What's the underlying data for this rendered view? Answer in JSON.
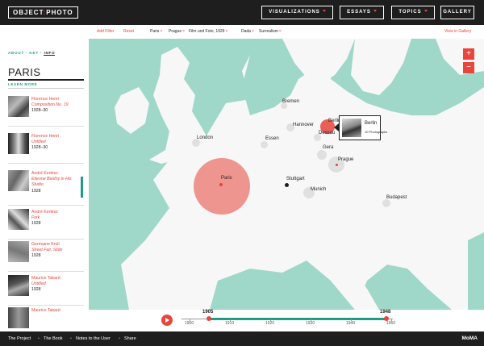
{
  "header": {
    "logo_left": "OBJECT",
    "logo_sep": ":",
    "logo_right": "PHOTO",
    "nav": [
      {
        "label": "VISUALIZATIONS",
        "has_menu": true
      },
      {
        "label": "ESSAYS",
        "has_menu": true
      },
      {
        "label": "TOPICS",
        "has_menu": true
      },
      {
        "label": "GALLERY",
        "has_menu": false
      }
    ]
  },
  "sidebar": {
    "tabs": [
      "ABOUT",
      "KEY",
      "INFO"
    ],
    "active_tab": "INFO",
    "title": "PARIS",
    "learn_more": "LEARN MORE",
    "items": [
      {
        "artist": "Florence Henri",
        "title": "Composition No. 19",
        "date": "1928–30"
      },
      {
        "artist": "Florence Henri",
        "title": "Untitled",
        "date": "1928–30"
      },
      {
        "artist": "André Kertész",
        "title": "Etienne Beothy in His Studio",
        "date": "1928"
      },
      {
        "artist": "André Kertész",
        "title": "Fork",
        "date": "1928"
      },
      {
        "artist": "Germaine Krull",
        "title": "Street Fair, Slide",
        "date": "1928"
      },
      {
        "artist": "Maurice Tabard",
        "title": "Untitled",
        "date": "1928"
      },
      {
        "artist": "Maurice Tabard",
        "title": "",
        "date": ""
      }
    ]
  },
  "filters": {
    "add_filter": "Add Filter",
    "reset": "Reset",
    "tags": [
      "Paris",
      "Prague",
      "Film und Foto, 1929",
      "Dada",
      "Surrealism"
    ],
    "remove_glyph": "×",
    "view_in_gallery": "View in Gallery"
  },
  "map": {
    "cities": [
      {
        "name": "Paris"
      },
      {
        "name": "London"
      },
      {
        "name": "Bremen"
      },
      {
        "name": "Hannover"
      },
      {
        "name": "Berlin"
      },
      {
        "name": "Essen"
      },
      {
        "name": "Dessau"
      },
      {
        "name": "Gera"
      },
      {
        "name": "Prague"
      },
      {
        "name": "Stuttgart"
      },
      {
        "name": "Munich"
      },
      {
        "name": "Budapest"
      }
    ],
    "zoom_in": "+",
    "zoom_out": "−",
    "colors": {
      "water": "#9fd8c8",
      "land": "#f7f7f7",
      "accent": "#e8453c",
      "teal": "#1f9c86"
    }
  },
  "tooltip": {
    "city": "Berlin",
    "count": "10 Photographs"
  },
  "timeline": {
    "start_year": "1905",
    "end_year": "1948",
    "ticks": [
      "1900",
      "1910",
      "1920",
      "1930",
      "1940",
      "1950"
    ],
    "play_icon": "play-icon"
  },
  "footer": {
    "links": [
      "The Project",
      "The Book",
      "Notes to the User",
      "Share"
    ],
    "separator": "•",
    "brand": "MoMA"
  }
}
